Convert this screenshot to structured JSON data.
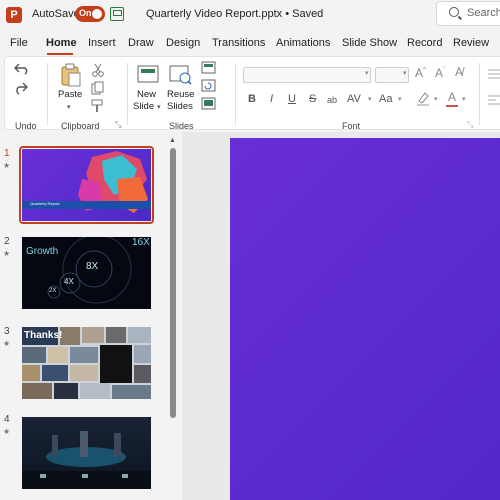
{
  "titlebar": {
    "app_logo": "P",
    "autosave_label": "AutoSave",
    "autosave_state": "On",
    "document_title": "Quarterly Video Report.pptx • Saved",
    "search_placeholder": "Search"
  },
  "tabs": [
    "File",
    "Home",
    "Insert",
    "Draw",
    "Design",
    "Transitions",
    "Animations",
    "Slide Show",
    "Record",
    "Review"
  ],
  "active_tab": "Home",
  "ribbon": {
    "groups": {
      "undo": "Undo",
      "clipboard": "Clipboard",
      "slides": "Slides",
      "font": "Font"
    },
    "paste_label": "Paste",
    "new_slide_label_1": "New",
    "new_slide_label_2": "Slide",
    "reuse_slides_label_1": "Reuse",
    "reuse_slides_label_2": "Slides",
    "format_buttons": [
      "B",
      "I",
      "U",
      "S",
      "ab",
      "AV",
      "Aa"
    ]
  },
  "thumbnails": [
    {
      "number": "1",
      "title": "Quarterly Report"
    },
    {
      "number": "2",
      "title": "Growth",
      "badges": [
        "16X",
        "8X",
        "4X",
        "2X"
      ]
    },
    {
      "number": "3",
      "title": "Thanks!"
    },
    {
      "number": "4",
      "title": ""
    }
  ],
  "colors": {
    "accent": "#c43e1c",
    "slide_bg": "#5a2ad0"
  }
}
